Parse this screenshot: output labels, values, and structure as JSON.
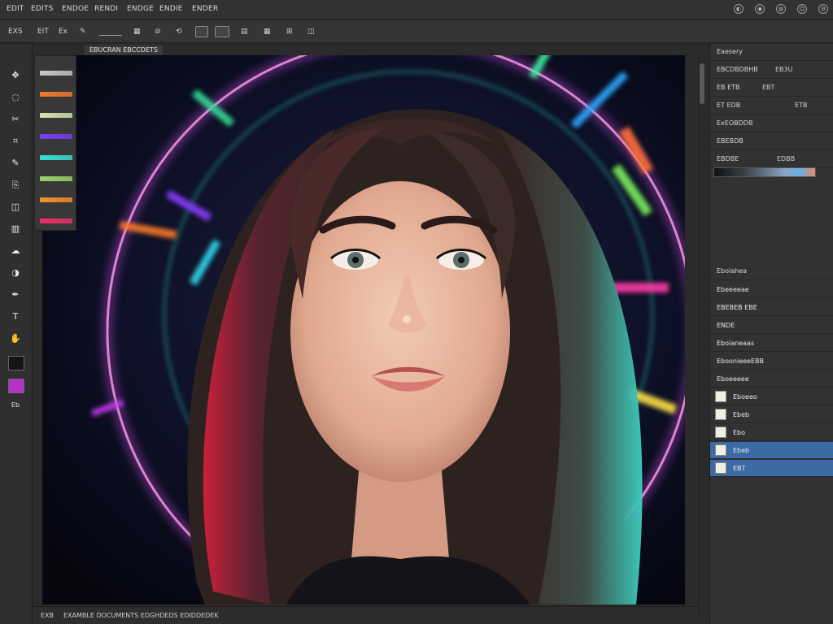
{
  "menu": {
    "items": [
      "EDIT",
      "EDITS",
      "ENDOE",
      "RENDI",
      "ENDGE",
      "ENDIE",
      "ENDER"
    ]
  },
  "window": {
    "controls": [
      "◐",
      "◉",
      "◍",
      "☺",
      "⚙"
    ]
  },
  "options": {
    "labels": [
      "EXS",
      "EIT",
      "Ex",
      "✎",
      "▦",
      "⊘",
      "⟲",
      "▤",
      "▦",
      "⊞",
      "◫"
    ]
  },
  "document": {
    "tab_label": "EBUCRAN EBCCDETS"
  },
  "tools": [
    {
      "name": "move-tool",
      "glyph": "✥"
    },
    {
      "name": "marquee-tool",
      "glyph": "◌"
    },
    {
      "name": "lasso-tool",
      "glyph": "✂"
    },
    {
      "name": "crop-tool",
      "glyph": "⌗"
    },
    {
      "name": "brush-tool",
      "glyph": "✎"
    },
    {
      "name": "clone-tool",
      "glyph": "⎘"
    },
    {
      "name": "eraser-tool",
      "glyph": "◫"
    },
    {
      "name": "gradient-tool",
      "glyph": "▥"
    },
    {
      "name": "blur-tool",
      "glyph": "☁"
    },
    {
      "name": "dodge-tool",
      "glyph": "◑"
    },
    {
      "name": "pen-tool",
      "glyph": "✒"
    },
    {
      "name": "text-tool",
      "glyph": "T"
    },
    {
      "name": "hand-tool",
      "glyph": "✋"
    },
    {
      "name": "zoom-tool",
      "glyph": "⌕"
    }
  ],
  "swatches": {
    "fg": "#b533c7",
    "bg": "#141414",
    "mini_label": "Eb"
  },
  "gradient_presets": [
    "#c8c8c8",
    "#f07a2c",
    "#d7e3b0",
    "#7a3cf0",
    "#3adfd7",
    "#9ad56a",
    "#f3902d",
    "#ef2f6a"
  ],
  "statusbar": {
    "zoom": "EXB",
    "info": "EXAMBLE DOCUMENTS EDGHDEDS EDIDDEDEK"
  },
  "panel": {
    "header": "Eaesery",
    "rows": [
      {
        "label": "EBCDBDBHB",
        "value": "EB3U"
      },
      {
        "label": "EB  ETB",
        "value": "EBT"
      },
      {
        "label": "ET   EDB",
        "value": "ETB"
      },
      {
        "label": "ExEOBDDB",
        "value": ""
      },
      {
        "label": "EBEBDB",
        "value": ""
      },
      {
        "label": "EBDBE",
        "value": "EDBB"
      }
    ],
    "layers_header": "Eboiahea",
    "layers": [
      {
        "name": "Ebeeeeae",
        "selected": false
      },
      {
        "name": "EBEBEB EBE",
        "selected": false
      },
      {
        "name": "ENDE",
        "selected": false
      },
      {
        "name": "Eboianeaas",
        "selected": false
      },
      {
        "name": "EboonieeeEBB",
        "selected": false
      },
      {
        "name": "Eboeeeee",
        "selected": false
      },
      {
        "name": "Eboeeo",
        "selected": false
      },
      {
        "name": "Ebeb",
        "selected": false
      },
      {
        "name": "Ebo",
        "selected": false
      },
      {
        "name": "Ebeb",
        "selected": true
      },
      {
        "name": "EBT",
        "selected": true
      }
    ]
  },
  "colors": {
    "accent": "#3c6aa5",
    "panel": "#323232",
    "canvas_bg": "#0b0b1a"
  }
}
